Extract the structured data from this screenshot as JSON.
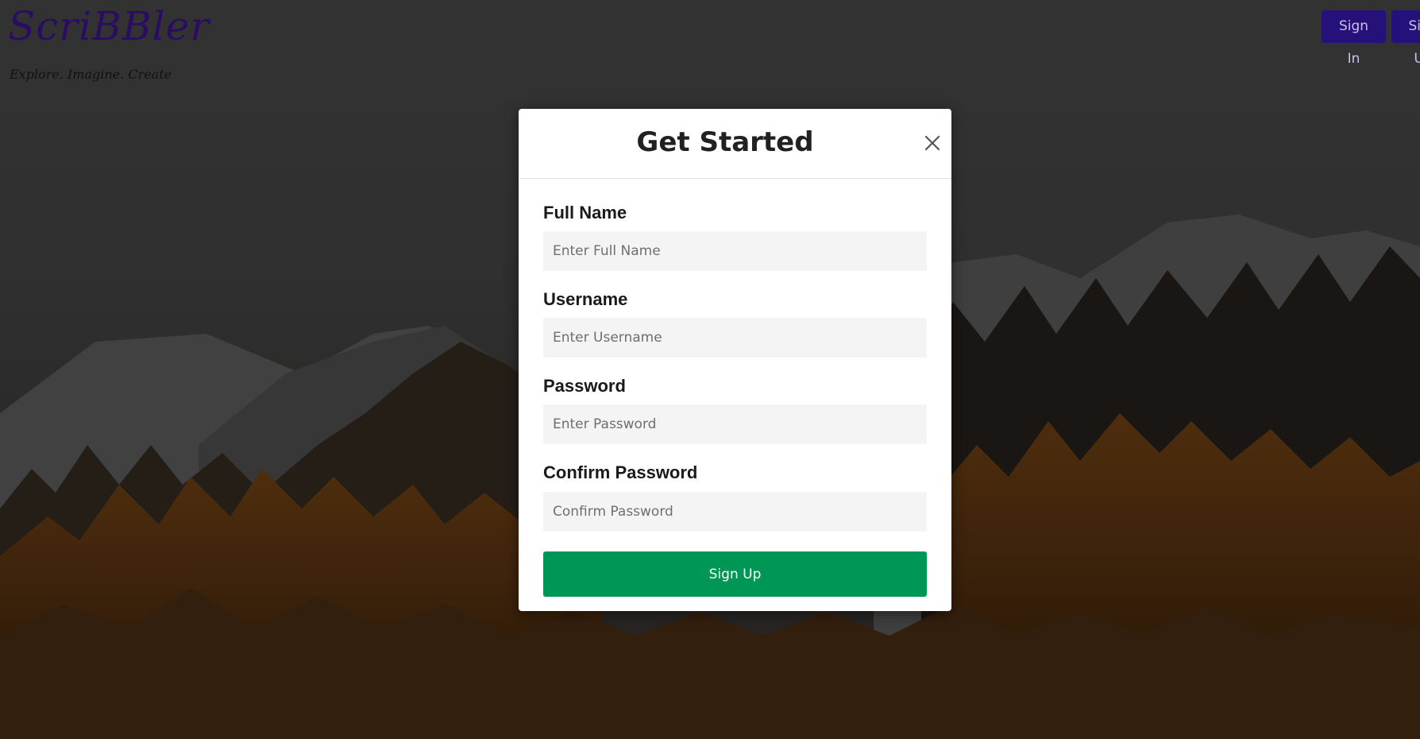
{
  "brand": {
    "name": "ScriBBler",
    "tagline": "Explore. Imagine. Create"
  },
  "nav": {
    "signin_label": "Sign In",
    "signup_label": "Sign Up"
  },
  "modal": {
    "title": "Get Started",
    "close_icon": "close-icon",
    "fields": [
      {
        "label": "Full Name",
        "placeholder": "Enter Full Name",
        "value": ""
      },
      {
        "label": "Username",
        "placeholder": "Enter Username",
        "value": ""
      },
      {
        "label": "Password",
        "placeholder": "Enter Password",
        "value": ""
      },
      {
        "label": "Confirm Password",
        "placeholder": "Confirm Password",
        "value": ""
      }
    ],
    "submit_label": "Sign Up"
  },
  "colors": {
    "brand": "#2a0d63",
    "nav_button": "#26107a",
    "submit_button": "#009655",
    "input_background": "#f4f4f4"
  }
}
